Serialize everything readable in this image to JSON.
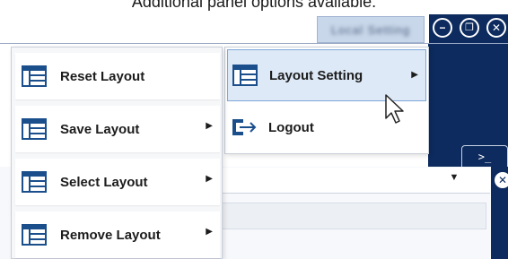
{
  "caption": "Additional panel options available.",
  "title_bar": {
    "user_name": "Local Setting",
    "buttons": [
      {
        "name": "minimize",
        "glyph": "−"
      },
      {
        "name": "restore",
        "glyph": "❐"
      },
      {
        "name": "close",
        "glyph": "✕"
      }
    ]
  },
  "terminal_tab": {
    "label": ">_"
  },
  "combo": {
    "arrow": "▼"
  },
  "panel_close": {
    "glyph": "✕"
  },
  "layout_menu": {
    "items": [
      {
        "label": "Reset Layout",
        "submenu": false,
        "icon": "layout-grid-icon"
      },
      {
        "label": "Save Layout",
        "submenu": true,
        "chevron": "▶",
        "icon": "layout-grid-icon"
      },
      {
        "label": "Select Layout",
        "submenu": true,
        "chevron": "▶",
        "icon": "layout-grid-icon"
      },
      {
        "label": "Remove Layout",
        "submenu": true,
        "chevron": "▶",
        "icon": "layout-grid-icon"
      }
    ]
  },
  "user_menu": {
    "items": [
      {
        "label": "Layout Setting",
        "submenu": true,
        "chevron": "▶",
        "hovered": true,
        "icon": "layout-grid-icon"
      },
      {
        "label": "Logout",
        "submenu": false,
        "icon": "logout-icon"
      }
    ]
  },
  "colors": {
    "navy": "#0d2b5e",
    "icon_blue": "#1b4f8c",
    "hover_bg": "#dde9f7",
    "hover_border": "#7fa8d8"
  }
}
